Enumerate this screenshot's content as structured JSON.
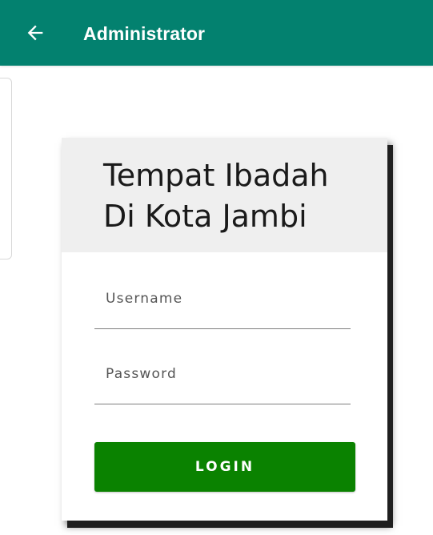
{
  "app_bar": {
    "back_icon": "arrow-left-icon",
    "title": "Administrator",
    "color": "#03816f"
  },
  "login_card": {
    "title_line1": "Tempat Ibadah",
    "title_line2": "Di Kota Jambi",
    "username": {
      "placeholder": "Username",
      "value": ""
    },
    "password": {
      "placeholder": "Password",
      "value": ""
    },
    "login_label": "LOGIN",
    "button_color": "#0a8200",
    "header_color": "#efefef"
  }
}
